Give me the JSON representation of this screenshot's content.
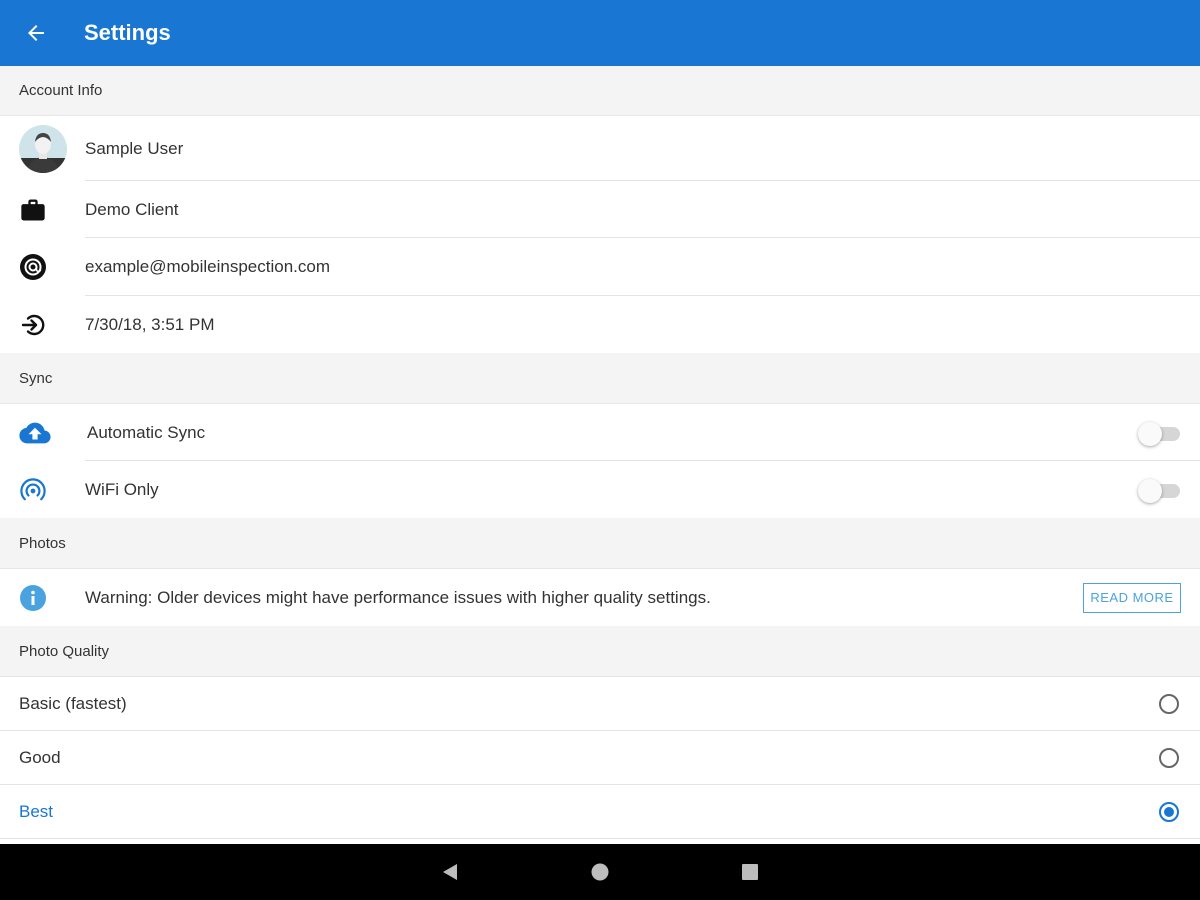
{
  "app_bar": {
    "title": "Settings",
    "background": "#1976d2",
    "back_icon": "arrow-back-icon"
  },
  "account_info": {
    "header": "Account Info",
    "user_name": "Sample User",
    "client": "Demo Client",
    "email": "example@mobileinspection.com",
    "last_login": "7/30/18, 3:51 PM"
  },
  "sync": {
    "header": "Sync",
    "automatic_sync": {
      "label": "Automatic Sync",
      "enabled": false,
      "icon": "cloud-upload-icon"
    },
    "wifi_only": {
      "label": "WiFi Only",
      "enabled": false,
      "icon": "wifi-tethering-icon"
    }
  },
  "photos": {
    "header": "Photos",
    "warning_text": "Warning: Older devices might have performance issues with higher quality settings.",
    "read_more_label": "READ MORE",
    "info_icon": "info-icon"
  },
  "photo_quality": {
    "header": "Photo Quality",
    "options": [
      {
        "label": "Basic (fastest)",
        "selected": false
      },
      {
        "label": "Good",
        "selected": false
      },
      {
        "label": "Best",
        "selected": true
      }
    ]
  },
  "colors": {
    "accent": "#1976d2",
    "section_bg": "#f4f4f4",
    "info_icon": "#4aa3df"
  }
}
